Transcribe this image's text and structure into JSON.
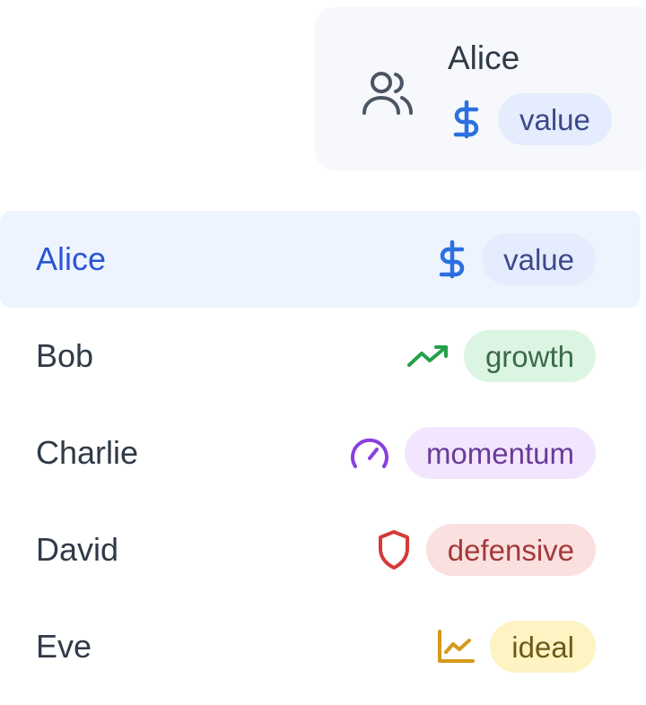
{
  "selector": {
    "selected_name": "Alice",
    "selected_tag": "value",
    "selected_icon": "dollar-icon",
    "leading_icon": "users-icon"
  },
  "options": [
    {
      "name": "Alice",
      "tag": "value",
      "icon": "dollar-icon",
      "color": "#2b6fe0",
      "selected": true
    },
    {
      "name": "Bob",
      "tag": "growth",
      "icon": "trending-up-icon",
      "color": "#23a04a",
      "selected": false
    },
    {
      "name": "Charlie",
      "tag": "momentum",
      "icon": "gauge-icon",
      "color": "#8b3fe0",
      "selected": false
    },
    {
      "name": "David",
      "tag": "defensive",
      "icon": "shield-icon",
      "color": "#d43a3a",
      "selected": false
    },
    {
      "name": "Eve",
      "tag": "ideal",
      "icon": "line-chart-icon",
      "color": "#d49a1a",
      "selected": false
    }
  ]
}
